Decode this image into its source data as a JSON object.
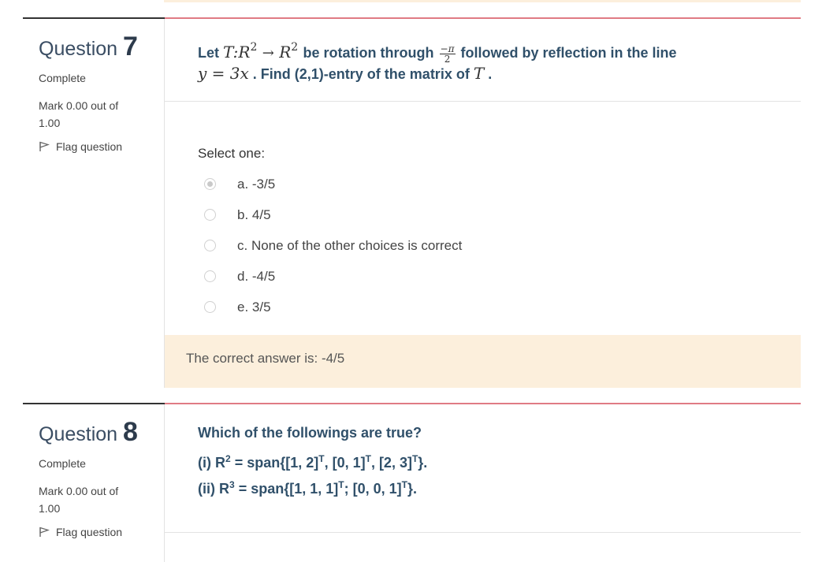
{
  "questions": [
    {
      "label": "Question",
      "number": "7",
      "state": "Complete",
      "mark": "Mark 0.00 out of 1.00",
      "flag": "Flag question",
      "text": {
        "let": "Let",
        "T": "T",
        "colon": ":",
        "R": "R",
        "exp": "2",
        "arrow": "→",
        "rotation": "be rotation through",
        "frac_num": "−π",
        "frac_den": "2",
        "followed": "followed by reflection in the line",
        "line_eq": "y = 3x",
        "find": ". Find (2,1)-entry of the matrix of",
        "end": "."
      },
      "prompt": "Select one:",
      "options": [
        {
          "label": "a. -3/5",
          "selected": true
        },
        {
          "label": "b. 4/5",
          "selected": false
        },
        {
          "label": "c. None of the other choices is correct",
          "selected": false
        },
        {
          "label": "d. -4/5",
          "selected": false
        },
        {
          "label": "e. 3/5",
          "selected": false
        }
      ],
      "feedback": "The correct answer is: -4/5"
    },
    {
      "label": "Question",
      "number": "8",
      "state": "Complete",
      "mark": "Mark 0.00 out of 1.00",
      "flag": "Flag question",
      "text": {
        "line1": "Which of the followings are true?",
        "line2_a": "(i) R",
        "line2_sup": "2",
        "line2_b": " = span{[1, 2]",
        "line2_t1": "T",
        "line2_c": ", [0, 1]",
        "line2_t2": "T",
        "line2_d": ", [2, 3]",
        "line2_t3": "T",
        "line2_e": "}.",
        "line3_a": "(ii) R",
        "line3_sup": "3",
        "line3_b": " = span{[1, 1, 1]",
        "line3_t1": "T",
        "line3_c": "; [0, 0, 1]",
        "line3_t2": "T",
        "line3_d": "}."
      }
    }
  ],
  "colors": {
    "accent_line": "#e07b84",
    "feedback_bg": "#fcefdc",
    "question_text": "#30506a"
  }
}
